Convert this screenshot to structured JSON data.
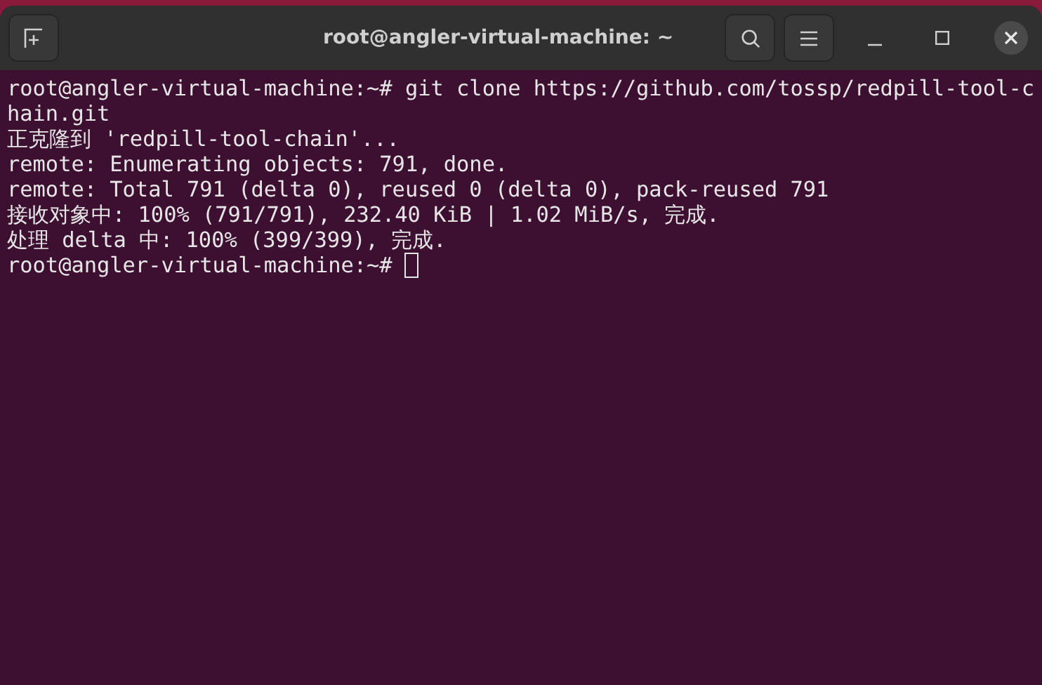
{
  "window": {
    "title": "root@angler-virtual-machine: ~"
  },
  "terminal": {
    "lines": [
      {
        "text": "root@angler-virtual-machine:~# git clone https://github.com/tossp/redpill-tool-c",
        "cursor": false
      },
      {
        "text": "hain.git",
        "cursor": false
      },
      {
        "text": "正克隆到 'redpill-tool-chain'...",
        "cursor": false
      },
      {
        "text": "remote: Enumerating objects: 791, done.",
        "cursor": false
      },
      {
        "text": "remote: Total 791 (delta 0), reused 0 (delta 0), pack-reused 791",
        "cursor": false
      },
      {
        "text": "接收对象中: 100% (791/791), 232.40 KiB | 1.02 MiB/s, 完成.",
        "cursor": false
      },
      {
        "text": "处理 delta 中: 100% (399/399), 完成.",
        "cursor": false
      },
      {
        "text": "root@angler-virtual-machine:~#",
        "cursor": true
      }
    ]
  }
}
